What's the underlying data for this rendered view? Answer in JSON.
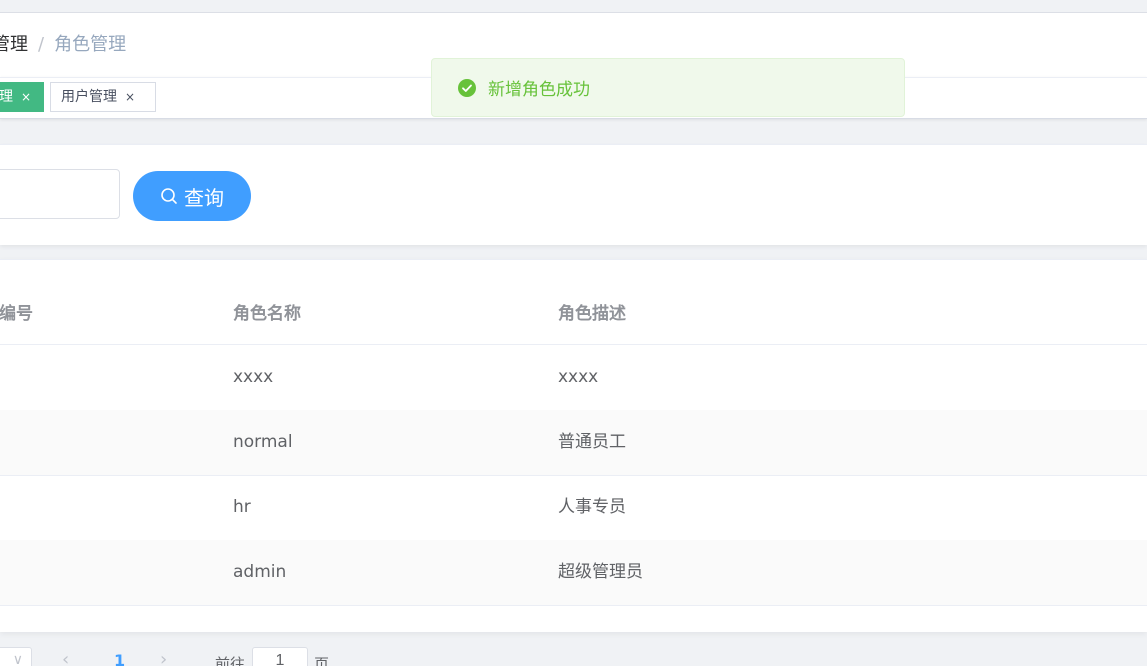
{
  "breadcrumb": {
    "parent": "管理",
    "separator": "/",
    "current": "角色管理"
  },
  "tags": [
    {
      "label": "理",
      "close": "×",
      "active": true
    },
    {
      "label": "用户管理",
      "close": "×",
      "active": false
    }
  ],
  "toast": {
    "message": "新增角色成功",
    "type": "success",
    "color": "#67c23a"
  },
  "search": {
    "input_value": "",
    "query_label": "查询"
  },
  "table": {
    "columns": [
      "色编号",
      "角色名称",
      "角色描述"
    ],
    "rows": [
      {
        "name": "xxxx",
        "description": "xxxx"
      },
      {
        "name": "normal",
        "description": "普通员工"
      },
      {
        "name": "hr",
        "description": "人事专员"
      },
      {
        "name": "admin",
        "description": "超级管理员"
      }
    ]
  },
  "pagination": {
    "prev": "‹",
    "current_page": "1",
    "next": "›",
    "goto_label": "前往",
    "goto_value": "1",
    "page_suffix": "页"
  },
  "colors": {
    "primary": "#409eff",
    "tag_active": "#42b983",
    "success": "#67c23a"
  }
}
